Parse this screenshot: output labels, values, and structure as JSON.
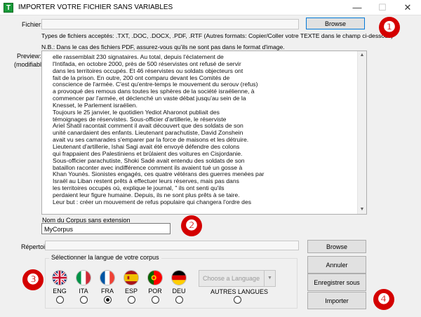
{
  "window": {
    "title": "IMPORTER VOTRE FICHIER SANS VARIABLES",
    "app_icon_letter": "T",
    "minimize_glyph": "—",
    "maximize_glyph": "☐",
    "close_glyph": "✕"
  },
  "file": {
    "label": "Fichier:",
    "value": "",
    "browse_label": "Browse",
    "types_note": "Types de fichiers acceptés: .TXT, .DOC, .DOCX, .PDF, .RTF (Autres formats: Copier/Coller votre TEXTE dans le champ ci-dessous)",
    "pdf_note": "N.B.: Dans le cas des fichiers PDF, assurez-vous qu'ils ne sont pas dans le format d'image."
  },
  "preview": {
    "label_line1": "Preview:",
    "label_line2": "(modifiable)",
    "text": "elle rassemblait 230 signataires. Au total, depuis l'éclatement de\nl'Intifada, en octobre 2000, près de 500 réservistes ont refusé de servir\ndans les territoires occupés. Et 46 réservistes ou soldats objecteurs ont\nfait de la prison. En outre, 200 ont comparu devant les Comités de\nconscience de l'armée. C'est qu'entre-temps le mouvement du serouv (refus)\na provoqué des remous dans toutes les sphères de la société israélienne, à\ncommencer par l'armée, et déclenché un vaste débat jusqu'au sein de la\nKnesset, le Parlement israélien.\nToujours le 25 janvier, le quotidien Yediot Aharonot publiait des\ntémoignages de réservistes. Sous-officier d'artillerie, le réserviste\nAriel Shatil racontait comment il avait découvert que des soldats de son\nunité canardaient des enfants. Lieutenant parachutiste, David Zonshein\navait vu ses camarades s'emparer par la force de maisons et les détruire.\nLieutenant d'artillerie, Ishai Sagi avait été envoyé défendre des colons\nqui frappaient des Palestiniens et brûlaient des voitures en Cisjordanie.\nSous-officier parachutiste, Shoki Sadé avait entendu des soldats de son\nbataillon raconter avec indifférence comment ils avaient tué un gosse à\nKhan Younès. Sionistes engagés, ces quatre vétérans des guerres menées par\nIsraël au Liban restent prêts à effectuer leurs réserves, mais pas dans\nles territoires occupés où, explique le journal, \" ils ont senti qu'ils\nperdaient leur figure humaine. Depuis, ils ne sont plus prêts à se taire.\nLeur but : créer un mouvement de refus populaire qui changera l'ordre des"
  },
  "corpus": {
    "label": "Nom du Corpus sans extension",
    "value": "MyCorpus"
  },
  "directory": {
    "label": "Répertoire :",
    "value": "",
    "browse_label": "Browse"
  },
  "language": {
    "group_title": "Sélectionner la langue de votre corpus",
    "options": [
      {
        "code": "ENG",
        "flag": "uk-flag-icon",
        "selected": false
      },
      {
        "code": "ITA",
        "flag": "italy-flag-icon",
        "selected": false
      },
      {
        "code": "FRA",
        "flag": "france-flag-icon",
        "selected": true
      },
      {
        "code": "ESP",
        "flag": "spain-flag-icon",
        "selected": false
      },
      {
        "code": "POR",
        "flag": "portugal-flag-icon",
        "selected": false
      },
      {
        "code": "DEU",
        "flag": "germany-flag-icon",
        "selected": false
      }
    ],
    "other_placeholder": "Choose a Language",
    "other_label": "AUTRES LANGUES"
  },
  "actions": {
    "cancel": "Annuler",
    "save_as": "Enregistrer sous",
    "import": "Importer"
  },
  "annotations": [
    "❶",
    "❷",
    "❸",
    "❹"
  ],
  "colors": {
    "badge": "#d40000",
    "accent": "#0078d7"
  }
}
